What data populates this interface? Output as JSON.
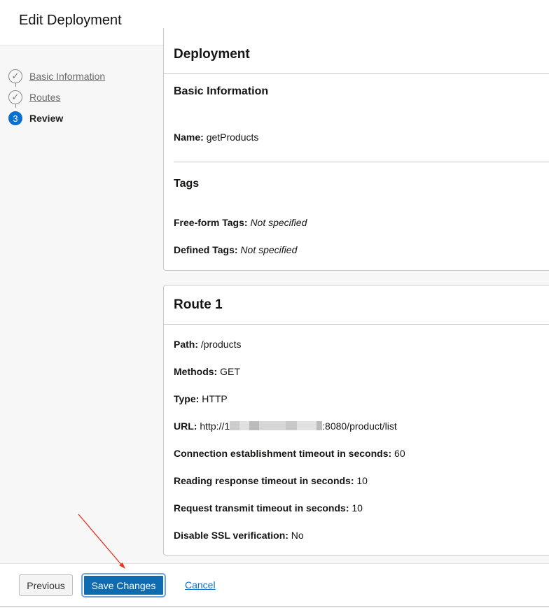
{
  "header": {
    "title": "Edit Deployment"
  },
  "steps": [
    {
      "label": "Basic Information",
      "state": "complete"
    },
    {
      "label": "Routes",
      "state": "complete"
    },
    {
      "label": "Review",
      "number": "3",
      "state": "current"
    }
  ],
  "deployment": {
    "title": "Deployment",
    "basic_title": "Basic Information",
    "name_label": "Name:",
    "name_value": "getProducts",
    "tags_title": "Tags",
    "freeform_label": "Free-form Tags:",
    "freeform_value": "Not specified",
    "defined_label": "Defined Tags:",
    "defined_value": "Not specified"
  },
  "route": {
    "title": "Route 1",
    "fields": [
      {
        "label": "Path:",
        "value": "/products"
      },
      {
        "label": "Methods:",
        "value": "GET"
      },
      {
        "label": "Type:",
        "value": "HTTP"
      },
      {
        "label": "URL:",
        "value_prefix": "http://1",
        "value_suffix": ":8080/product/list"
      },
      {
        "label": "Connection establishment timeout in seconds:",
        "value": "60"
      },
      {
        "label": "Reading response timeout in seconds:",
        "value": "10"
      },
      {
        "label": "Request transmit timeout in seconds:",
        "value": "10"
      },
      {
        "label": "Disable SSL verification:",
        "value": "No"
      }
    ]
  },
  "footer": {
    "previous": "Previous",
    "save": "Save Changes",
    "cancel": "Cancel"
  },
  "colors": {
    "primary": "#0e6bb0",
    "annotation_arrow": "#e8321e"
  }
}
